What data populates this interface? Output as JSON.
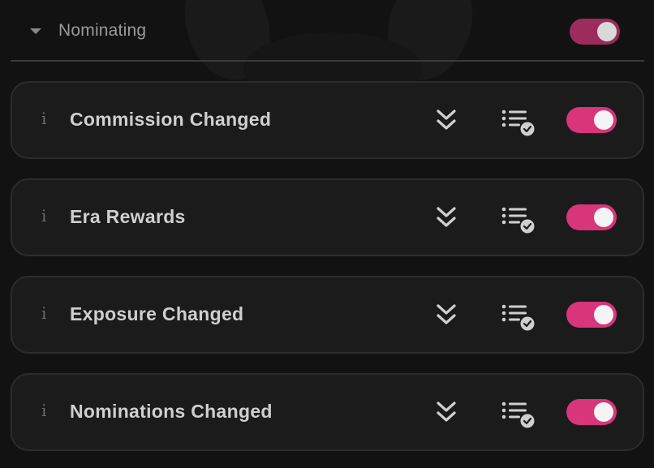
{
  "section": {
    "title": "Nominating",
    "enabled": true
  },
  "items": [
    {
      "label": "Commission Changed",
      "info": "i",
      "enabled": true
    },
    {
      "label": "Era Rewards",
      "info": "i",
      "enabled": true
    },
    {
      "label": "Exposure Changed",
      "info": "i",
      "enabled": true
    },
    {
      "label": "Nominations Changed",
      "info": "i",
      "enabled": true
    }
  ],
  "icons": {
    "caret": "caret-down-icon",
    "expand": "double-chevron-down-icon",
    "subscriptions": "list-check-icon",
    "info": "info-icon"
  },
  "colors": {
    "accent": "#d8357a",
    "background": "#121212",
    "card": "#1b1b1b",
    "text": "#cfcfcf"
  }
}
